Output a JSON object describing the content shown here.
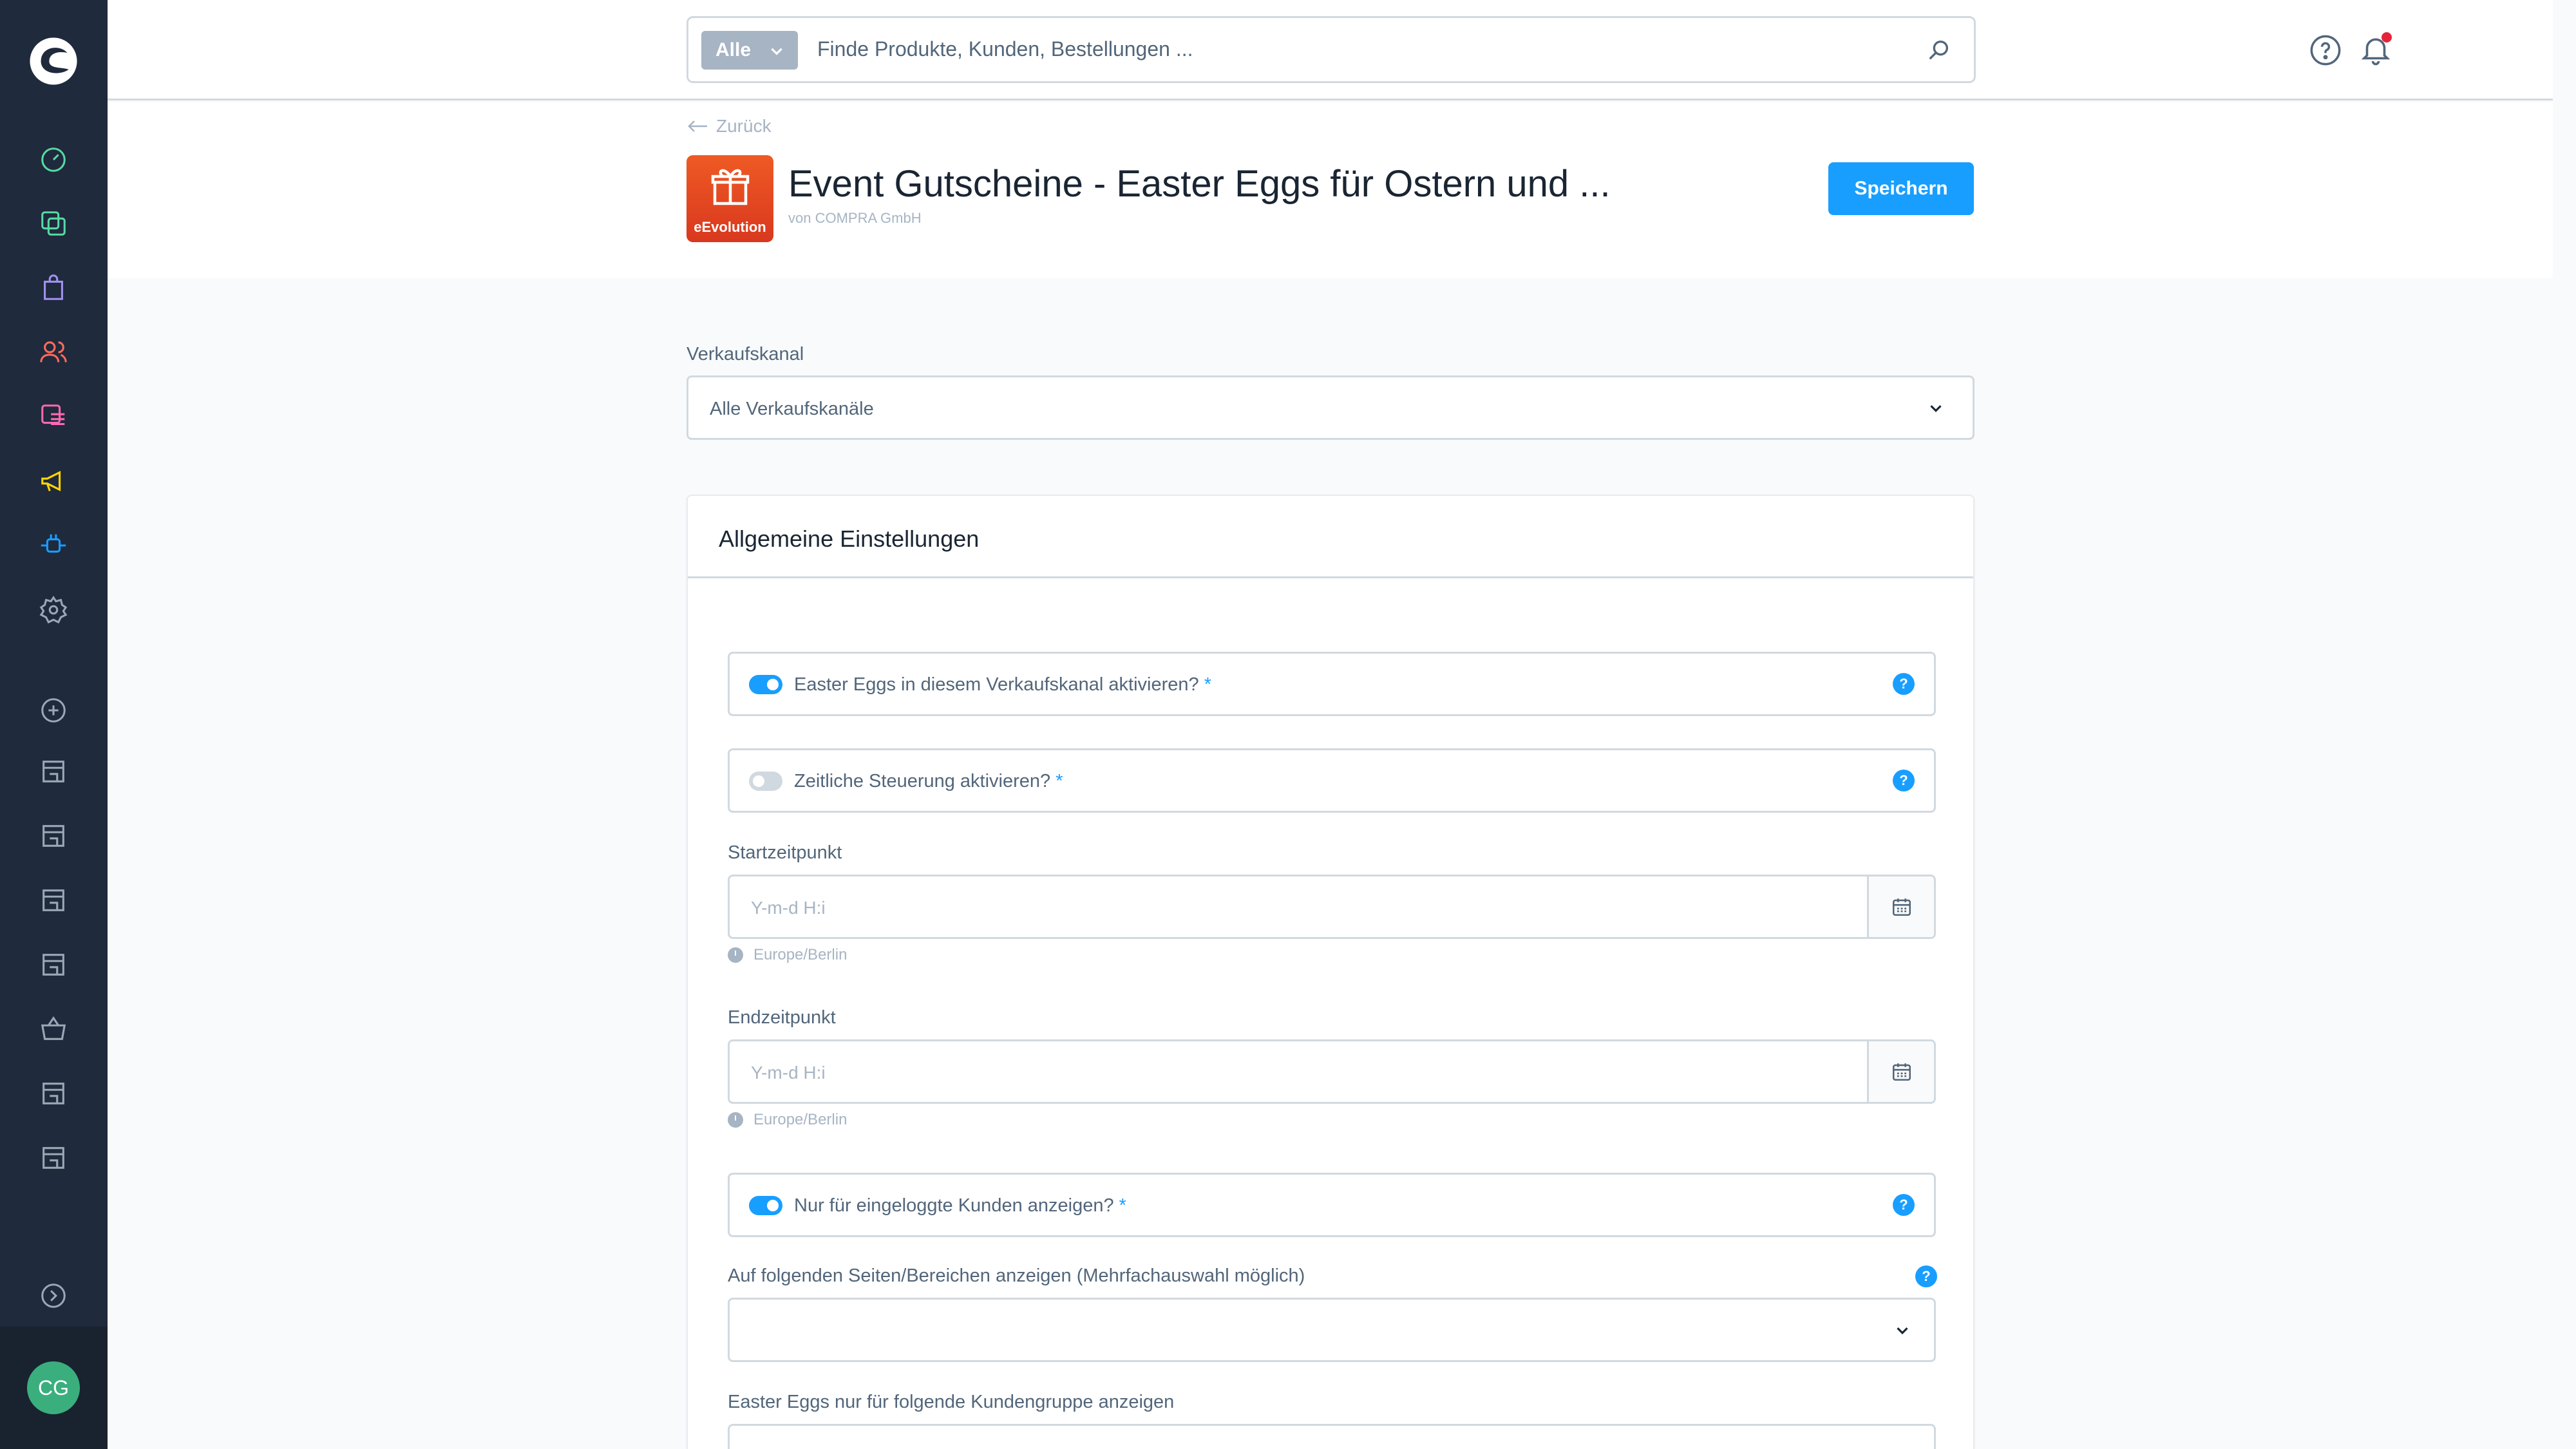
{
  "sidebar": {
    "nav": [
      {
        "name": "dashboard-icon",
        "color": "#57d9a3"
      },
      {
        "name": "catalog-icon",
        "color": "#57d9a3"
      },
      {
        "name": "orders-icon",
        "color": "#a092f0"
      },
      {
        "name": "customers-icon",
        "color": "#ff6c5c"
      },
      {
        "name": "content-icon",
        "color": "#ff68b4"
      },
      {
        "name": "marketing-icon",
        "color": "#ffd700"
      },
      {
        "name": "extensions-icon",
        "color": "#189eff"
      },
      {
        "name": "settings-icon",
        "color": "#9aa8b5"
      }
    ],
    "avatar_initials": "CG"
  },
  "search": {
    "type_label": "Alle",
    "placeholder": "Finde Produkte, Kunden, Bestellungen ..."
  },
  "header": {
    "back_label": "Zurück",
    "app_logo_text": "eEvolution",
    "title": "Event Gutscheine - Easter Eggs für Ostern und ...",
    "subtitle": "von COMPRA GmbH",
    "save_label": "Speichern"
  },
  "sales_channel": {
    "label": "Verkaufskanal",
    "value": "Alle Verkaufskanäle"
  },
  "card": {
    "title": "Allgemeine Einstellungen",
    "activate_label": "Easter Eggs in diesem Verkaufskanal aktivieren?",
    "activate_on": true,
    "schedule_label": "Zeitliche Steuerung aktivieren?",
    "schedule_on": false,
    "required_mark": "*",
    "help_mark": "?",
    "start_label": "Startzeitpunkt",
    "start_placeholder": "Y-m-d H:i",
    "start_tz": "Europe/Berlin",
    "end_label": "Endzeitpunkt",
    "end_placeholder": "Y-m-d H:i",
    "end_tz": "Europe/Berlin",
    "logged_in_label": "Nur für eingeloggte Kunden anzeigen?",
    "logged_in_on": true,
    "pages_label": "Auf folgenden Seiten/Bereichen anzeigen (Mehrfachauswahl möglich)",
    "pages_value": "",
    "groups_label": "Easter Eggs nur für folgende Kundengruppe anzeigen"
  },
  "colors": {
    "accent": "#189eff",
    "sidebar": "#1f2a3c",
    "avatar": "#3bae7e",
    "notification": "#e5243b"
  }
}
